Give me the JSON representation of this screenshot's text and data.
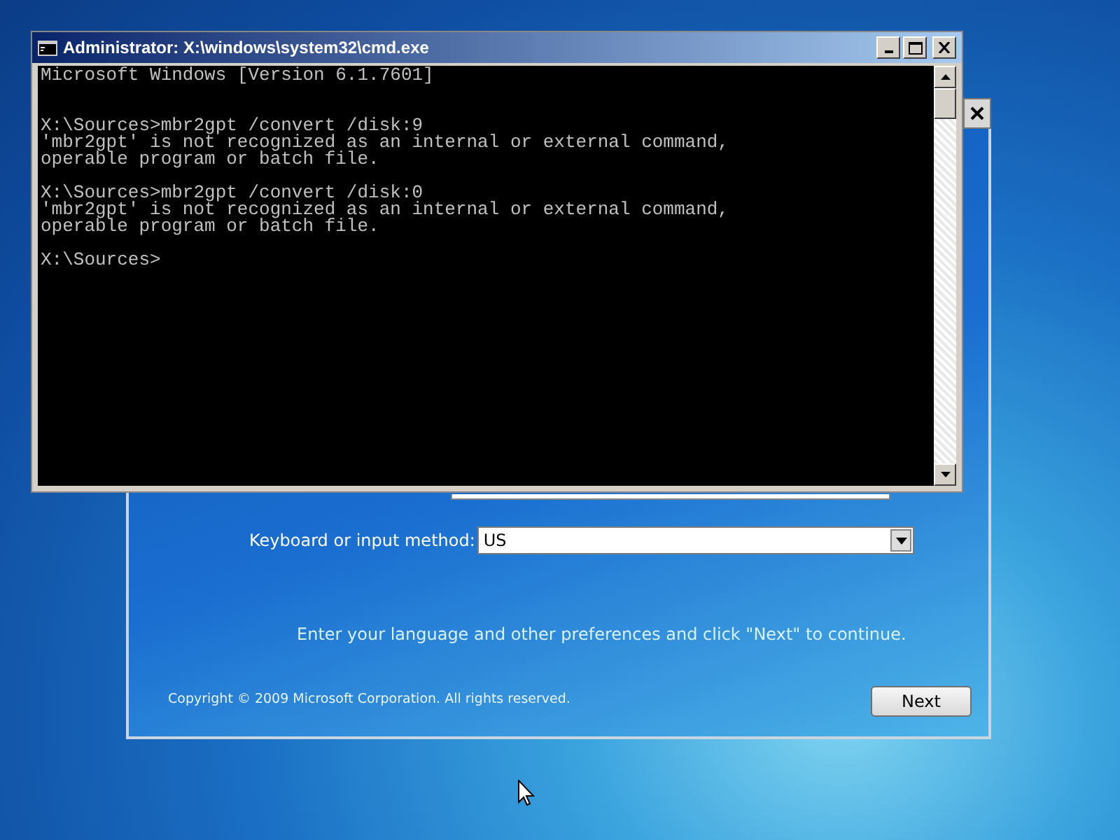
{
  "setup_window": {
    "keyboard_label": "Keyboard or input method:",
    "keyboard_value": "US",
    "instruction": "Enter your language and other preferences and click \"Next\" to continue.",
    "copyright": "Copyright © 2009 Microsoft Corporation. All rights reserved.",
    "next_button": "Next"
  },
  "cmd_window": {
    "title": "Administrator: X:\\windows\\system32\\cmd.exe",
    "blocks": [
      {
        "lines": [
          "Microsoft Windows [Version 6.1.7601]"
        ]
      },
      {
        "lines": [
          "X:\\Sources>mbr2gpt /convert /disk:9",
          "'mbr2gpt' is not recognized as an internal or external command,",
          "operable program or batch file."
        ]
      },
      {
        "lines": [
          "X:\\Sources>mbr2gpt /convert /disk:0",
          "'mbr2gpt' is not recognized as an internal or external command,",
          "operable program or batch file."
        ]
      },
      {
        "lines": [
          "X:\\Sources>"
        ]
      }
    ]
  }
}
